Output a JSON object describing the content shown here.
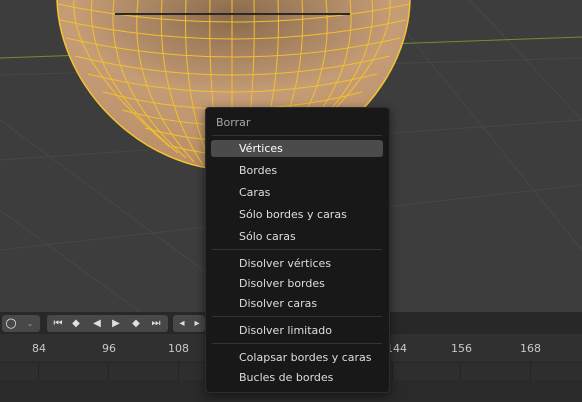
{
  "menu": {
    "title": "Borrar",
    "items": [
      {
        "label": "Vértices",
        "active": true
      },
      {
        "label": "Bordes"
      },
      {
        "label": "Caras"
      },
      {
        "label": "Sólo bordes y caras"
      },
      {
        "label": "Sólo caras"
      },
      {
        "label": "Disolver vértices"
      },
      {
        "label": "Disolver bordes"
      },
      {
        "label": "Disolver caras"
      },
      {
        "label": "Disolver limitado"
      },
      {
        "label": "Colapsar bordes y caras"
      },
      {
        "label": "Bucles de bordes"
      }
    ]
  },
  "timeline": {
    "frames": [
      "84",
      "96",
      "108",
      "144",
      "156",
      "168"
    ]
  },
  "playback": {
    "icons": [
      "circle-icon",
      "chevron-down-icon",
      "jump-start-icon",
      "prev-keyframe-icon",
      "play-reverse-icon",
      "play-icon",
      "next-keyframe-icon",
      "jump-end-icon",
      "step-back-icon",
      "step-forward-icon"
    ]
  },
  "colors": {
    "wireframe": "#f2c12e",
    "mesh_fill": "#c8a27a",
    "active_item": "#4b4b4b",
    "menu_bg": "#181818"
  }
}
